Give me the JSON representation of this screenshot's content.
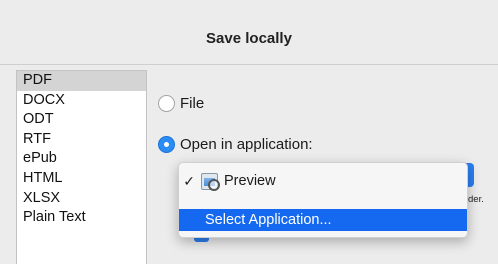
{
  "window": {
    "title": "Save locally"
  },
  "formats": [
    "PDF",
    "DOCX",
    "ODT",
    "RTF",
    "ePub",
    "HTML",
    "XLSX",
    "Plain Text"
  ],
  "selected_format": "PDF",
  "options": {
    "file_label": "File",
    "open_in_app_label": "Open in application:",
    "selected_option": "open_in_app"
  },
  "app_menu": {
    "checkmark": "✓",
    "current_app": "Preview",
    "select_app_label": "Select Application..."
  },
  "partial_text": "der.",
  "colors": {
    "accent": "#2a8cf5",
    "menu_highlight": "#1469f0",
    "list_selection": "#d4d4d4"
  }
}
